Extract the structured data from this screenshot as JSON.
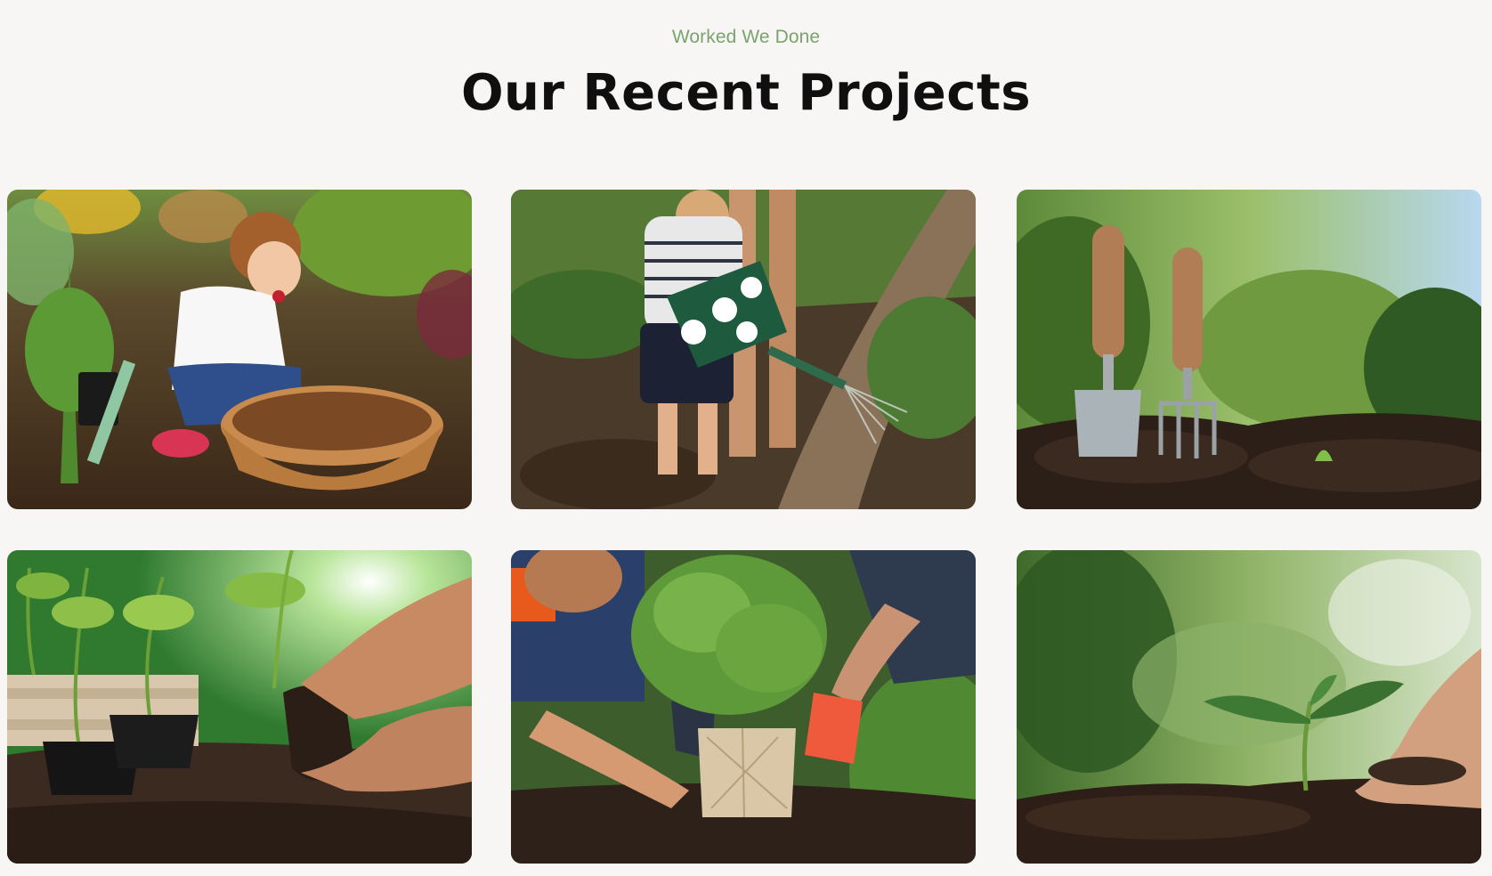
{
  "section": {
    "eyebrow": "Worked We Done",
    "title": "Our Recent Projects"
  },
  "colors": {
    "accent": "#7aa36e",
    "heading": "#0f0f0f",
    "background": "#f7f6f4"
  }
}
